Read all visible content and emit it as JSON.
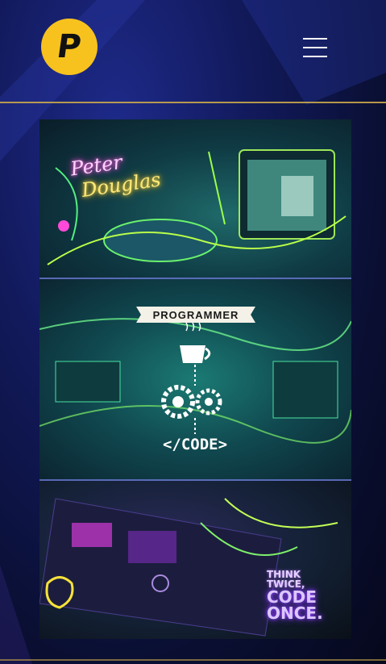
{
  "header": {
    "logo_letter": "P",
    "menu_icon": "hamburger-menu-icon"
  },
  "hero": {
    "signature_line1": "Peter",
    "signature_line2": "Douglas",
    "banner": "PROGRAMMER",
    "code_label": "</CODE>",
    "motto_line1": "THINK",
    "motto_line2": "TWICE,",
    "motto_line3": "CODE",
    "motto_line4": "ONCE."
  },
  "colors": {
    "accent": "#f7c21d",
    "rule": "#c9a64a",
    "background": "#121a5c"
  }
}
